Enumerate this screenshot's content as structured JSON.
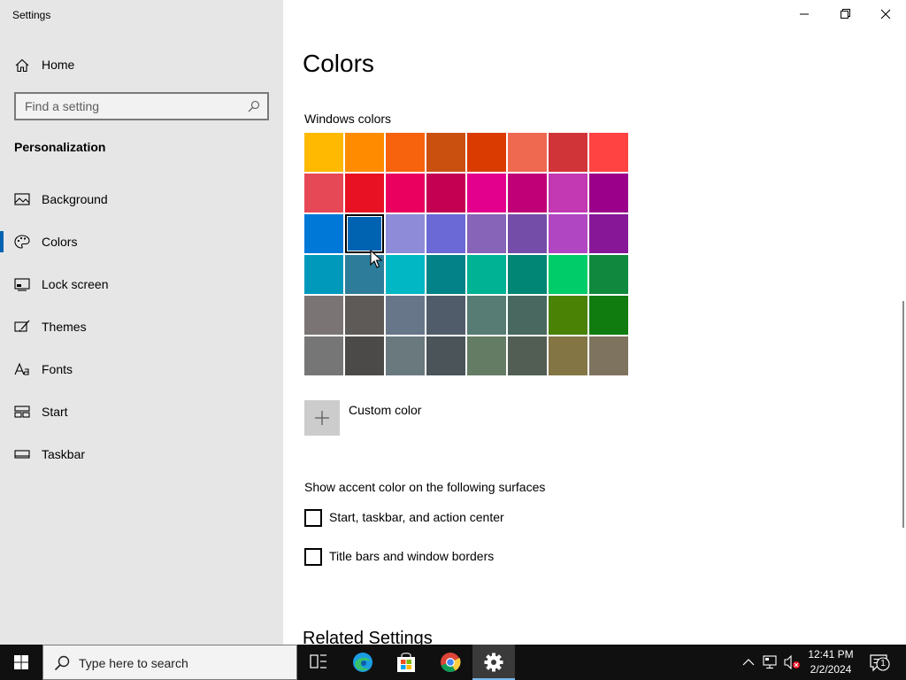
{
  "app": {
    "title": "Settings"
  },
  "sidebar": {
    "home_label": "Home",
    "search_placeholder": "Find a setting",
    "section_title": "Personalization",
    "items": [
      {
        "label": "Background",
        "icon": "picture-icon"
      },
      {
        "label": "Colors",
        "icon": "palette-icon",
        "active": true
      },
      {
        "label": "Lock screen",
        "icon": "lock-screen-icon"
      },
      {
        "label": "Themes",
        "icon": "brush-icon"
      },
      {
        "label": "Fonts",
        "icon": "font-icon"
      },
      {
        "label": "Start",
        "icon": "start-tiles-icon"
      },
      {
        "label": "Taskbar",
        "icon": "taskbar-icon"
      }
    ]
  },
  "main": {
    "title": "Colors",
    "windows_colors_label": "Windows colors",
    "swatches": [
      "#ffb900",
      "#ff8c00",
      "#f7630c",
      "#ca5010",
      "#da3b01",
      "#ef6950",
      "#d13438",
      "#ff4343",
      "#e74856",
      "#e81123",
      "#ea005e",
      "#c30052",
      "#e3008c",
      "#bf0077",
      "#c239b3",
      "#9a0089",
      "#0078d7",
      "#0063b1",
      "#8e8cd8",
      "#6b69d6",
      "#8764b8",
      "#744da9",
      "#b146c2",
      "#881798",
      "#0099bc",
      "#2d7d9a",
      "#00b7c3",
      "#038387",
      "#00b294",
      "#018574",
      "#00cc6a",
      "#10893e",
      "#7a7574",
      "#5d5a58",
      "#68768a",
      "#515c6b",
      "#567c73",
      "#486860",
      "#498205",
      "#107c10",
      "#767676",
      "#4c4a48",
      "#69797e",
      "#4a5459",
      "#647c64",
      "#525e54",
      "#847545",
      "#7e735f"
    ],
    "selected_swatch": 17,
    "custom_color_label": "Custom color",
    "surfaces_title": "Show accent color on the following surfaces",
    "checkboxes": [
      {
        "label": "Start, taskbar, and action center",
        "checked": false
      },
      {
        "label": "Title bars and window borders",
        "checked": false
      }
    ],
    "related_settings": "Related Settings"
  },
  "taskbar": {
    "search_placeholder": "Type here to search",
    "time": "12:41 PM",
    "date": "2/2/2024",
    "notification_count": "1",
    "accent": "#76b9ed"
  }
}
